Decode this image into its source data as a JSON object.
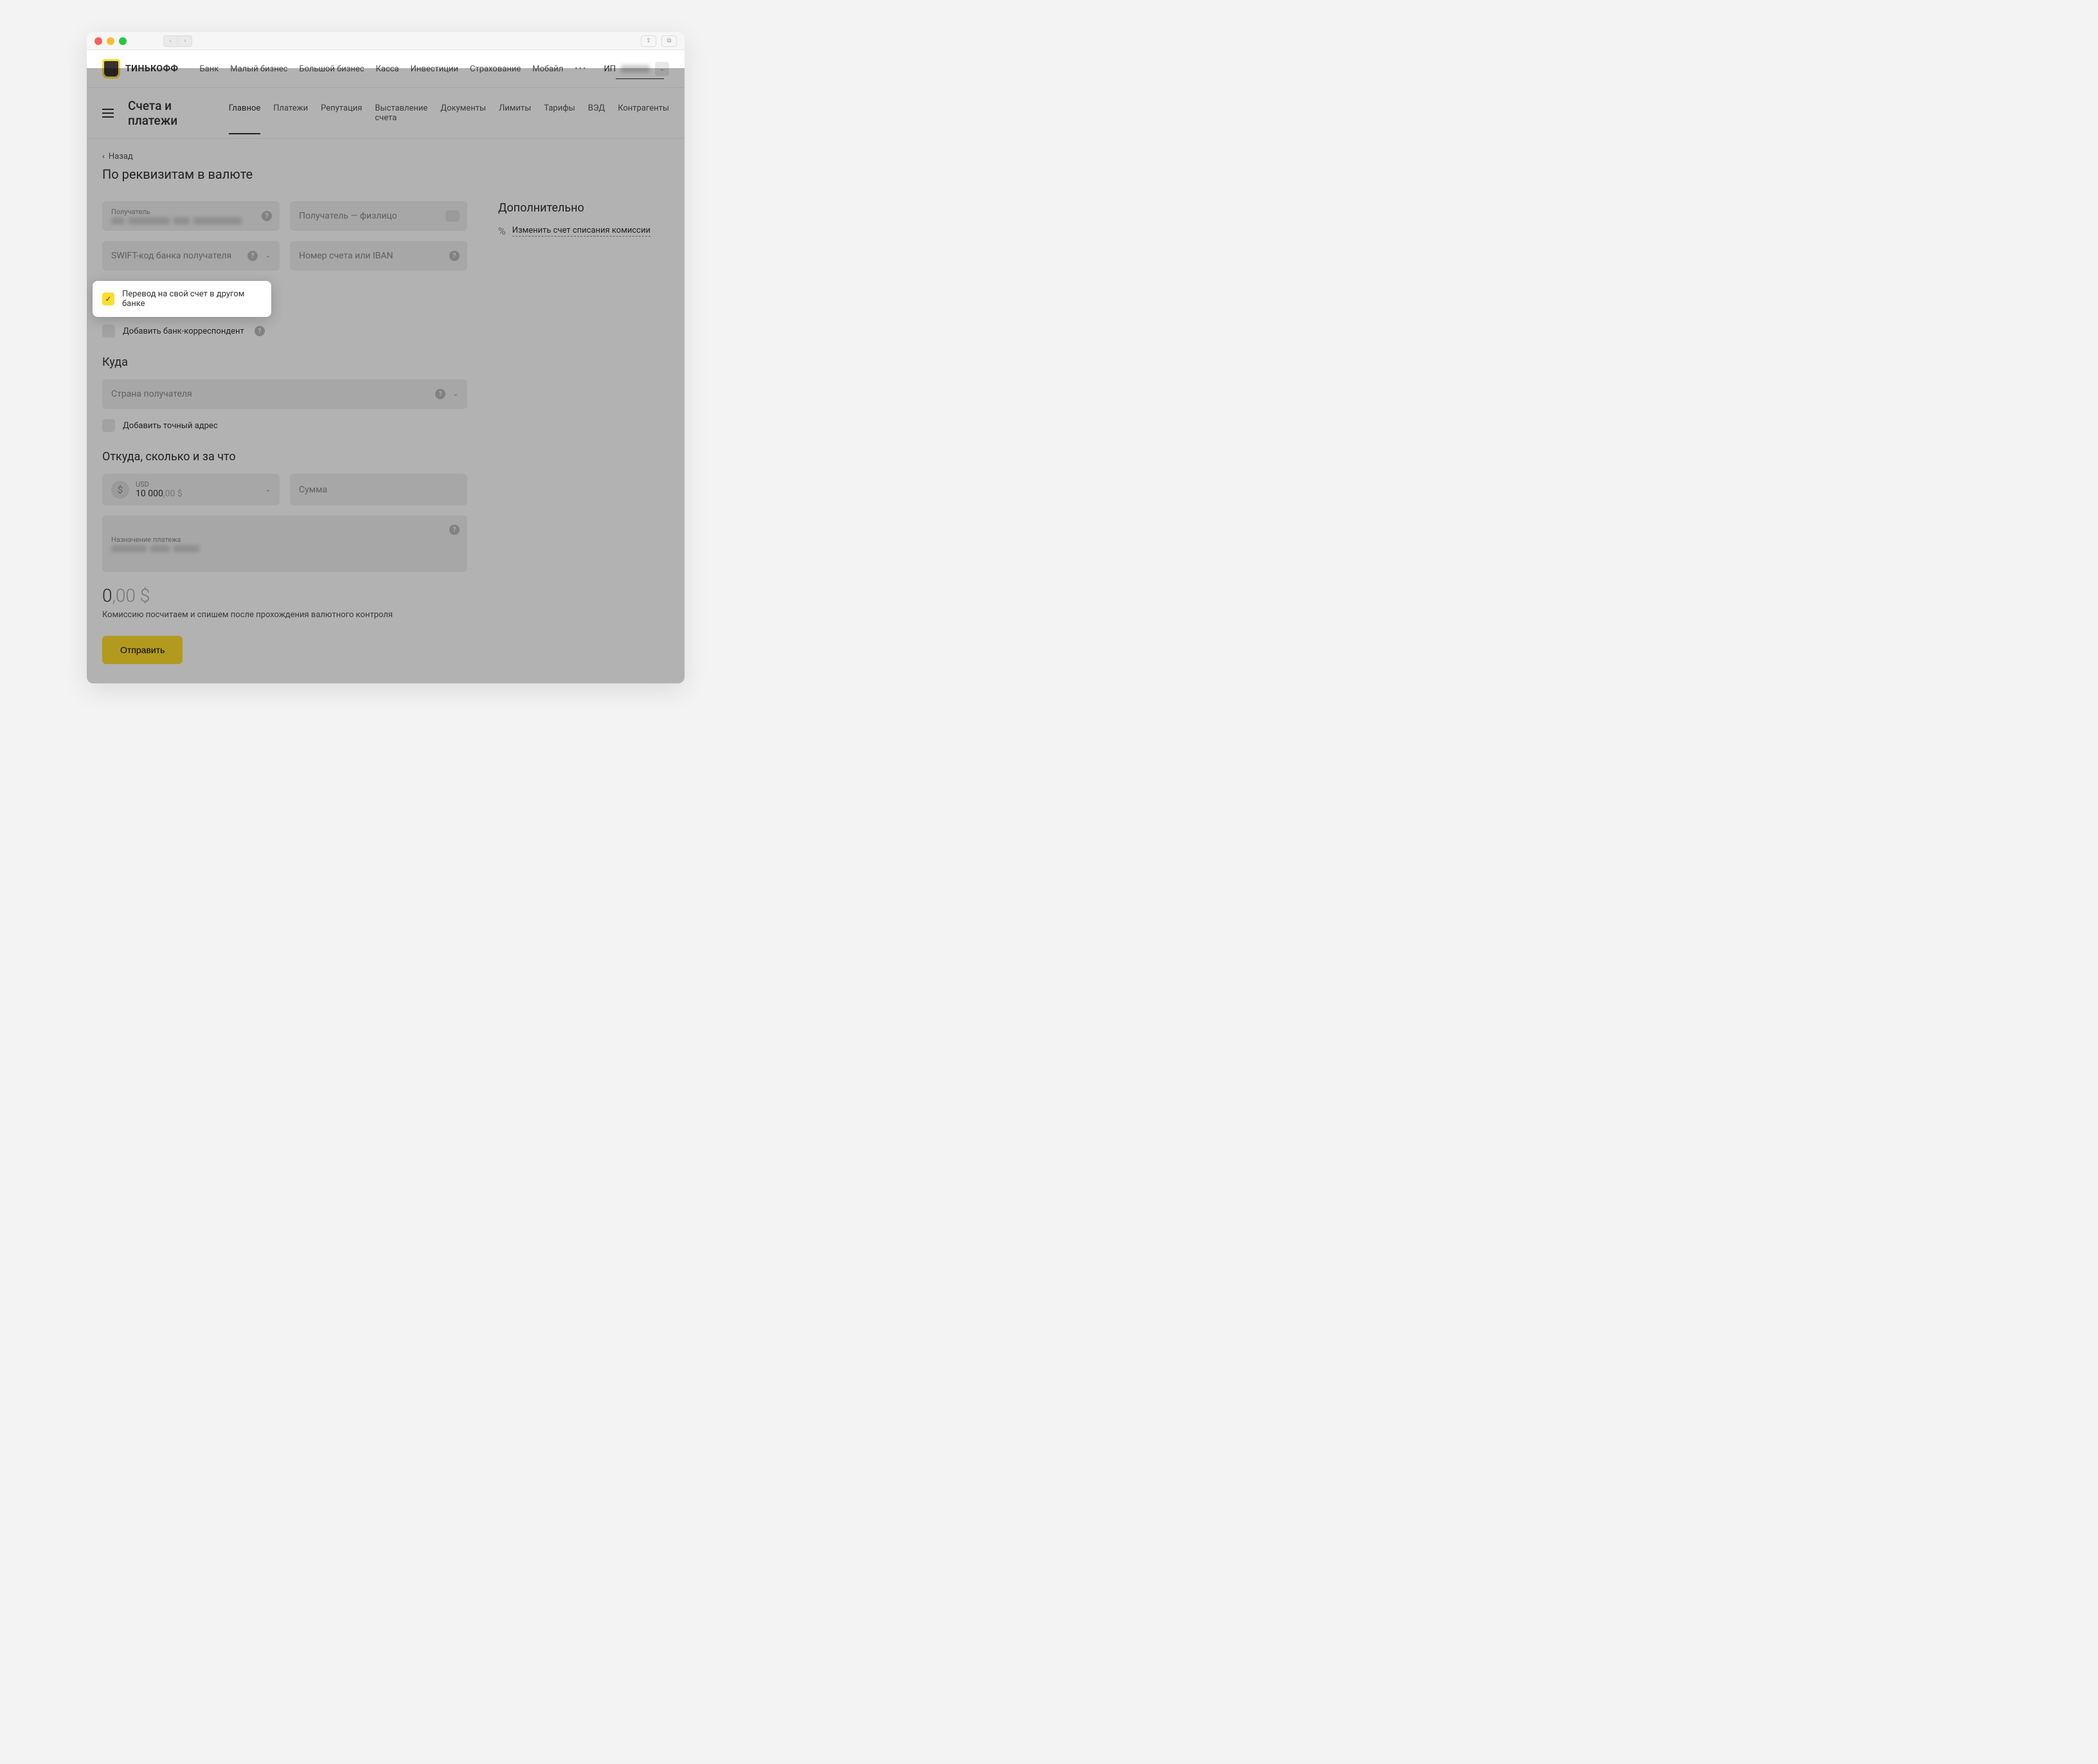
{
  "brand": "ТИНЬКОФФ",
  "topnav": [
    "Банк",
    "Малый бизнес",
    "Большой бизнес",
    "Касса",
    "Инвестиции",
    "Страхование",
    "Мобайл"
  ],
  "user_prefix": "ИП",
  "subnav_title": "Счета и платежи",
  "subnav": [
    "Главное",
    "Платежи",
    "Репутация",
    "Выставление счета",
    "Документы",
    "Лимиты",
    "Тарифы",
    "ВЭД",
    "Контрагенты"
  ],
  "subnav_active": "Главное",
  "back": "Назад",
  "page_title": "По реквизитам в валюте",
  "fields": {
    "recipient_label": "Получатель",
    "recipient_type": "Получатель — физлицо",
    "swift": "SWIFT-код банка получателя",
    "iban": "Номер счета или IBAN",
    "country": "Страна получателя",
    "amount_placeholder": "Сумма",
    "purpose_label": "Назначение платежа",
    "currency_code": "USD",
    "currency_amount": "10 000",
    "currency_dec": ",00 $"
  },
  "checkboxes": {
    "own_account": "Перевод на свой счет в другом банке",
    "correspondent": "Добавить банк-корреспондент",
    "exact_address": "Добавить точный адрес"
  },
  "sections": {
    "where": "Куда",
    "from": "Откуда, сколько и за что"
  },
  "total_int": "0",
  "total_dec": ",00 $",
  "total_note": "Комиссию посчитаем и спишем после прохождения валютного контроля",
  "submit": "Отправить",
  "aside": {
    "title": "Дополнительно",
    "commission": "Изменить счет списания комиссии"
  }
}
